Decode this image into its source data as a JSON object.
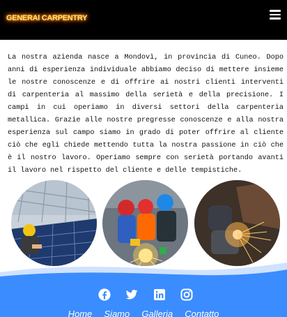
{
  "header": {
    "brand": "GENERAl CARPENTRY",
    "menu_icon": "hamburger-menu-icon"
  },
  "intro": {
    "text": "La nostra azienda nasce a Mondovì, in provincia di Cuneo. Dopo anni di esperienza individuale abbiamo deciso di mettere insieme le nostre conoscenze e di offrire ai nostri clienti interventi di carpenteria al massimo della serietà e della precisione. I campi in cui operiamo in diversi settori della carpenteria metallica. Grazie alle nostre pregresse conoscenze e alla nostra esperienza sul campo siamo in grado di poter offrire al cliente ciò che egli chiede mettendo tutta la nostra passione in ciò che è il nostro lavoro. Operiamo sempre con serietà portando avanti il lavoro nel rispetto del cliente e delle tempistiche."
  },
  "footer": {
    "social": [
      "facebook-icon",
      "twitter-icon",
      "linkedin-icon",
      "instagram-icon"
    ],
    "links": [
      "Home",
      "Siamo",
      "Galleria",
      "Contatto"
    ]
  },
  "colors": {
    "header_bg": "#000000",
    "brand_glow": "#ff8a00",
    "footer_bg": "#3b8cff",
    "wave_light": "#cfe2ff"
  }
}
